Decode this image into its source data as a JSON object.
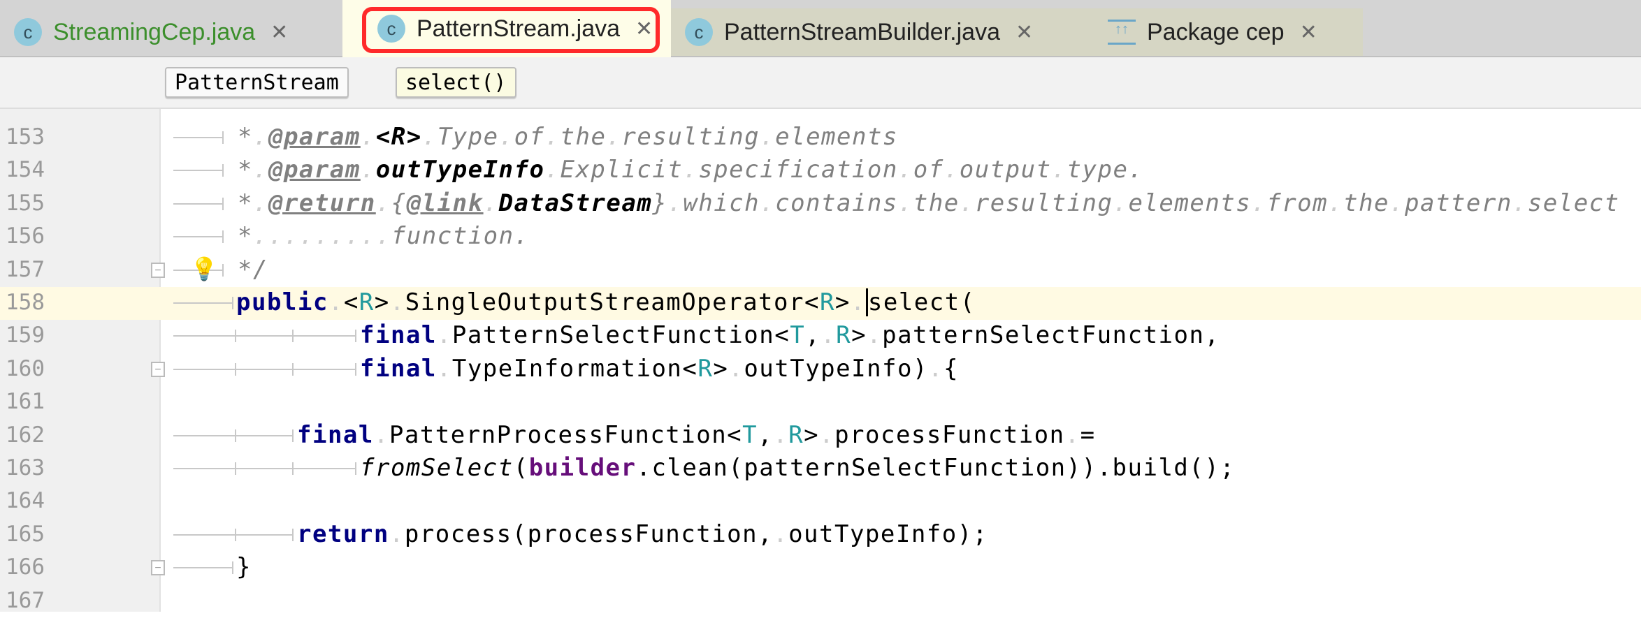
{
  "tabs": [
    {
      "label": "StreamingCep.java",
      "color": "#3c8f2c",
      "icon": "java-class-run-icon"
    },
    {
      "label": "PatternStream.java",
      "color": "#222222",
      "icon": "java-class-locked-icon",
      "active": true,
      "highlighted": true
    },
    {
      "label": "PatternStreamBuilder.java",
      "color": "#222222",
      "icon": "java-class-locked-icon"
    },
    {
      "label": "Package cep",
      "color": "#222222",
      "icon": "package-icon"
    }
  ],
  "breadcrumbs": [
    "PatternStream",
    "select()"
  ],
  "lines": [
    {
      "n": "153",
      "segs": [
        [
          "comment",
          "* "
        ],
        [
          "tag",
          "@param"
        ],
        [
          "comment",
          " "
        ],
        [
          "cref",
          "<R>"
        ],
        [
          "comment",
          " Type of the resulting elements"
        ]
      ]
    },
    {
      "n": "154",
      "segs": [
        [
          "comment",
          "* "
        ],
        [
          "tag",
          "@param"
        ],
        [
          "comment",
          " "
        ],
        [
          "cref",
          "outTypeInfo"
        ],
        [
          "comment",
          " Explicit specification of output type."
        ]
      ]
    },
    {
      "n": "155",
      "segs": [
        [
          "comment",
          "* "
        ],
        [
          "tag",
          "@return"
        ],
        [
          "comment",
          " {"
        ],
        [
          "tag",
          "@link"
        ],
        [
          "comment",
          " "
        ],
        [
          "cref",
          "DataStream"
        ],
        [
          "comment",
          "} which contains the resulting elements from the pattern select"
        ]
      ]
    },
    {
      "n": "156",
      "segs": [
        [
          "comment",
          "*         function."
        ]
      ]
    },
    {
      "n": "157",
      "segs": [
        [
          "comment",
          "*/"
        ]
      ]
    },
    {
      "n": "158",
      "segs": [
        [
          "kw",
          "public"
        ],
        [
          "",
          "",
          " "
        ],
        [
          "",
          "<"
        ],
        [
          "gen",
          "R"
        ],
        [
          "",
          "> SingleOutputStreamOperator<"
        ],
        [
          "gen",
          "R"
        ],
        [
          "",
          "> "
        ],
        [
          "caret",
          "select"
        ],
        [
          "",
          "("
        ]
      ]
    },
    {
      "n": "159",
      "segs": [
        [
          "kw",
          "final"
        ],
        [
          "",
          " PatternSelectFunction<"
        ],
        [
          "gen",
          "T"
        ],
        [
          "",
          ", "
        ],
        [
          "gen",
          "R"
        ],
        [
          "",
          "> patternSelectFunction,"
        ]
      ]
    },
    {
      "n": "160",
      "segs": [
        [
          "kw",
          "final"
        ],
        [
          "",
          " TypeInformation<"
        ],
        [
          "gen",
          "R"
        ],
        [
          "",
          "> outTypeInfo) {"
        ]
      ]
    },
    {
      "n": "161",
      "segs": []
    },
    {
      "n": "162",
      "segs": [
        [
          "kw",
          "final"
        ],
        [
          "",
          " PatternProcessFunction<"
        ],
        [
          "gen",
          "T"
        ],
        [
          "",
          ", "
        ],
        [
          "gen",
          "R"
        ],
        [
          "",
          "> processFunction ="
        ]
      ]
    },
    {
      "n": "163",
      "segs": [
        [
          "ital",
          "fromSelect"
        ],
        [
          "",
          "("
        ],
        [
          "fld",
          "builder"
        ],
        [
          "",
          ".clean(patternSelectFunction)).build();"
        ]
      ]
    },
    {
      "n": "164",
      "segs": []
    },
    {
      "n": "165",
      "segs": [
        [
          "kw",
          "return"
        ],
        [
          "",
          " process(processFunction, outTypeInfo);"
        ]
      ]
    },
    {
      "n": "166",
      "segs": [
        [
          "",
          "}"
        ]
      ]
    },
    {
      "n": "167",
      "segs": []
    }
  ],
  "highlight_color": "#ff2a2a",
  "current_line": "158"
}
